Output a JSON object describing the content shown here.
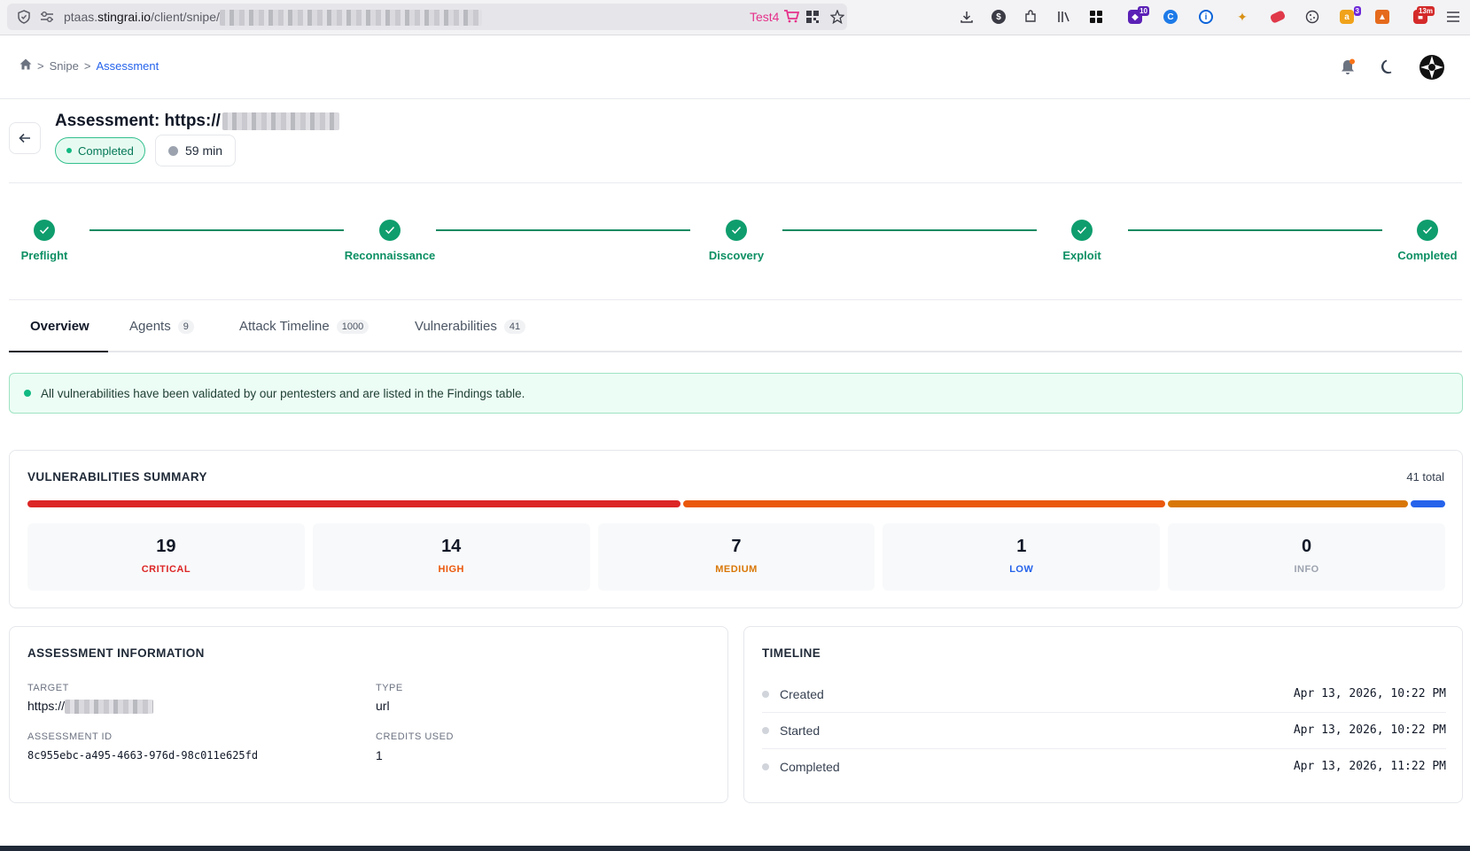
{
  "browser": {
    "url_prefix": "ptaas.",
    "url_domain": "stingrai.io",
    "url_path": "/client/snipe/",
    "profile_label": "Test4",
    "extension_badges": {
      "tab_counter": "10",
      "ext_three": "3",
      "timer": "13m"
    }
  },
  "header": {
    "breadcrumb": {
      "root": "Snipe",
      "current": "Assessment",
      "sep": ">"
    }
  },
  "assessment": {
    "title": "Assessment: https://",
    "status": "Completed",
    "duration": "59 min"
  },
  "stepper": {
    "steps": [
      {
        "label": "Preflight",
        "done": true
      },
      {
        "label": "Reconnaissance",
        "done": true
      },
      {
        "label": "Discovery",
        "done": true
      },
      {
        "label": "Exploit",
        "done": true
      },
      {
        "label": "Completed",
        "done": true
      }
    ]
  },
  "tabs": [
    {
      "label": "Overview",
      "count": null,
      "active": true
    },
    {
      "label": "Agents",
      "count": "9"
    },
    {
      "label": "Attack Timeline",
      "count": "1000"
    },
    {
      "label": "Vulnerabilities",
      "count": "41"
    }
  ],
  "banner": {
    "text": "All vulnerabilities have been validated by our pentesters and are listed in the Findings table."
  },
  "vuln_summary": {
    "title": "VULNERABILITIES SUMMARY",
    "total_label": "41 total",
    "total": 41,
    "items": [
      {
        "count": 19,
        "label": "CRITICAL",
        "color": "#dc2626"
      },
      {
        "count": 14,
        "label": "HIGH",
        "color": "#ea580c"
      },
      {
        "count": 7,
        "label": "MEDIUM",
        "color": "#d97706"
      },
      {
        "count": 1,
        "label": "LOW",
        "color": "#2563eb"
      },
      {
        "count": 0,
        "label": "INFO",
        "color": "#9ca3af"
      }
    ]
  },
  "info": {
    "title": "ASSESSMENT INFORMATION",
    "target_label": "TARGET",
    "target_value": "https://",
    "type_label": "TYPE",
    "type_value": "url",
    "id_label": "ASSESSMENT ID",
    "id_value": "8c955ebc-a495-4663-976d-98c011e625fd",
    "credits_label": "CREDITS USED",
    "credits_value": "1"
  },
  "timeline": {
    "title": "TIMELINE",
    "rows": [
      {
        "label": "Created",
        "time": "Apr 13, 2026, 10:22 PM"
      },
      {
        "label": "Started",
        "time": "Apr 13, 2026, 10:22 PM"
      },
      {
        "label": "Completed",
        "time": "Apr 13, 2026, 11:22 PM"
      }
    ]
  }
}
